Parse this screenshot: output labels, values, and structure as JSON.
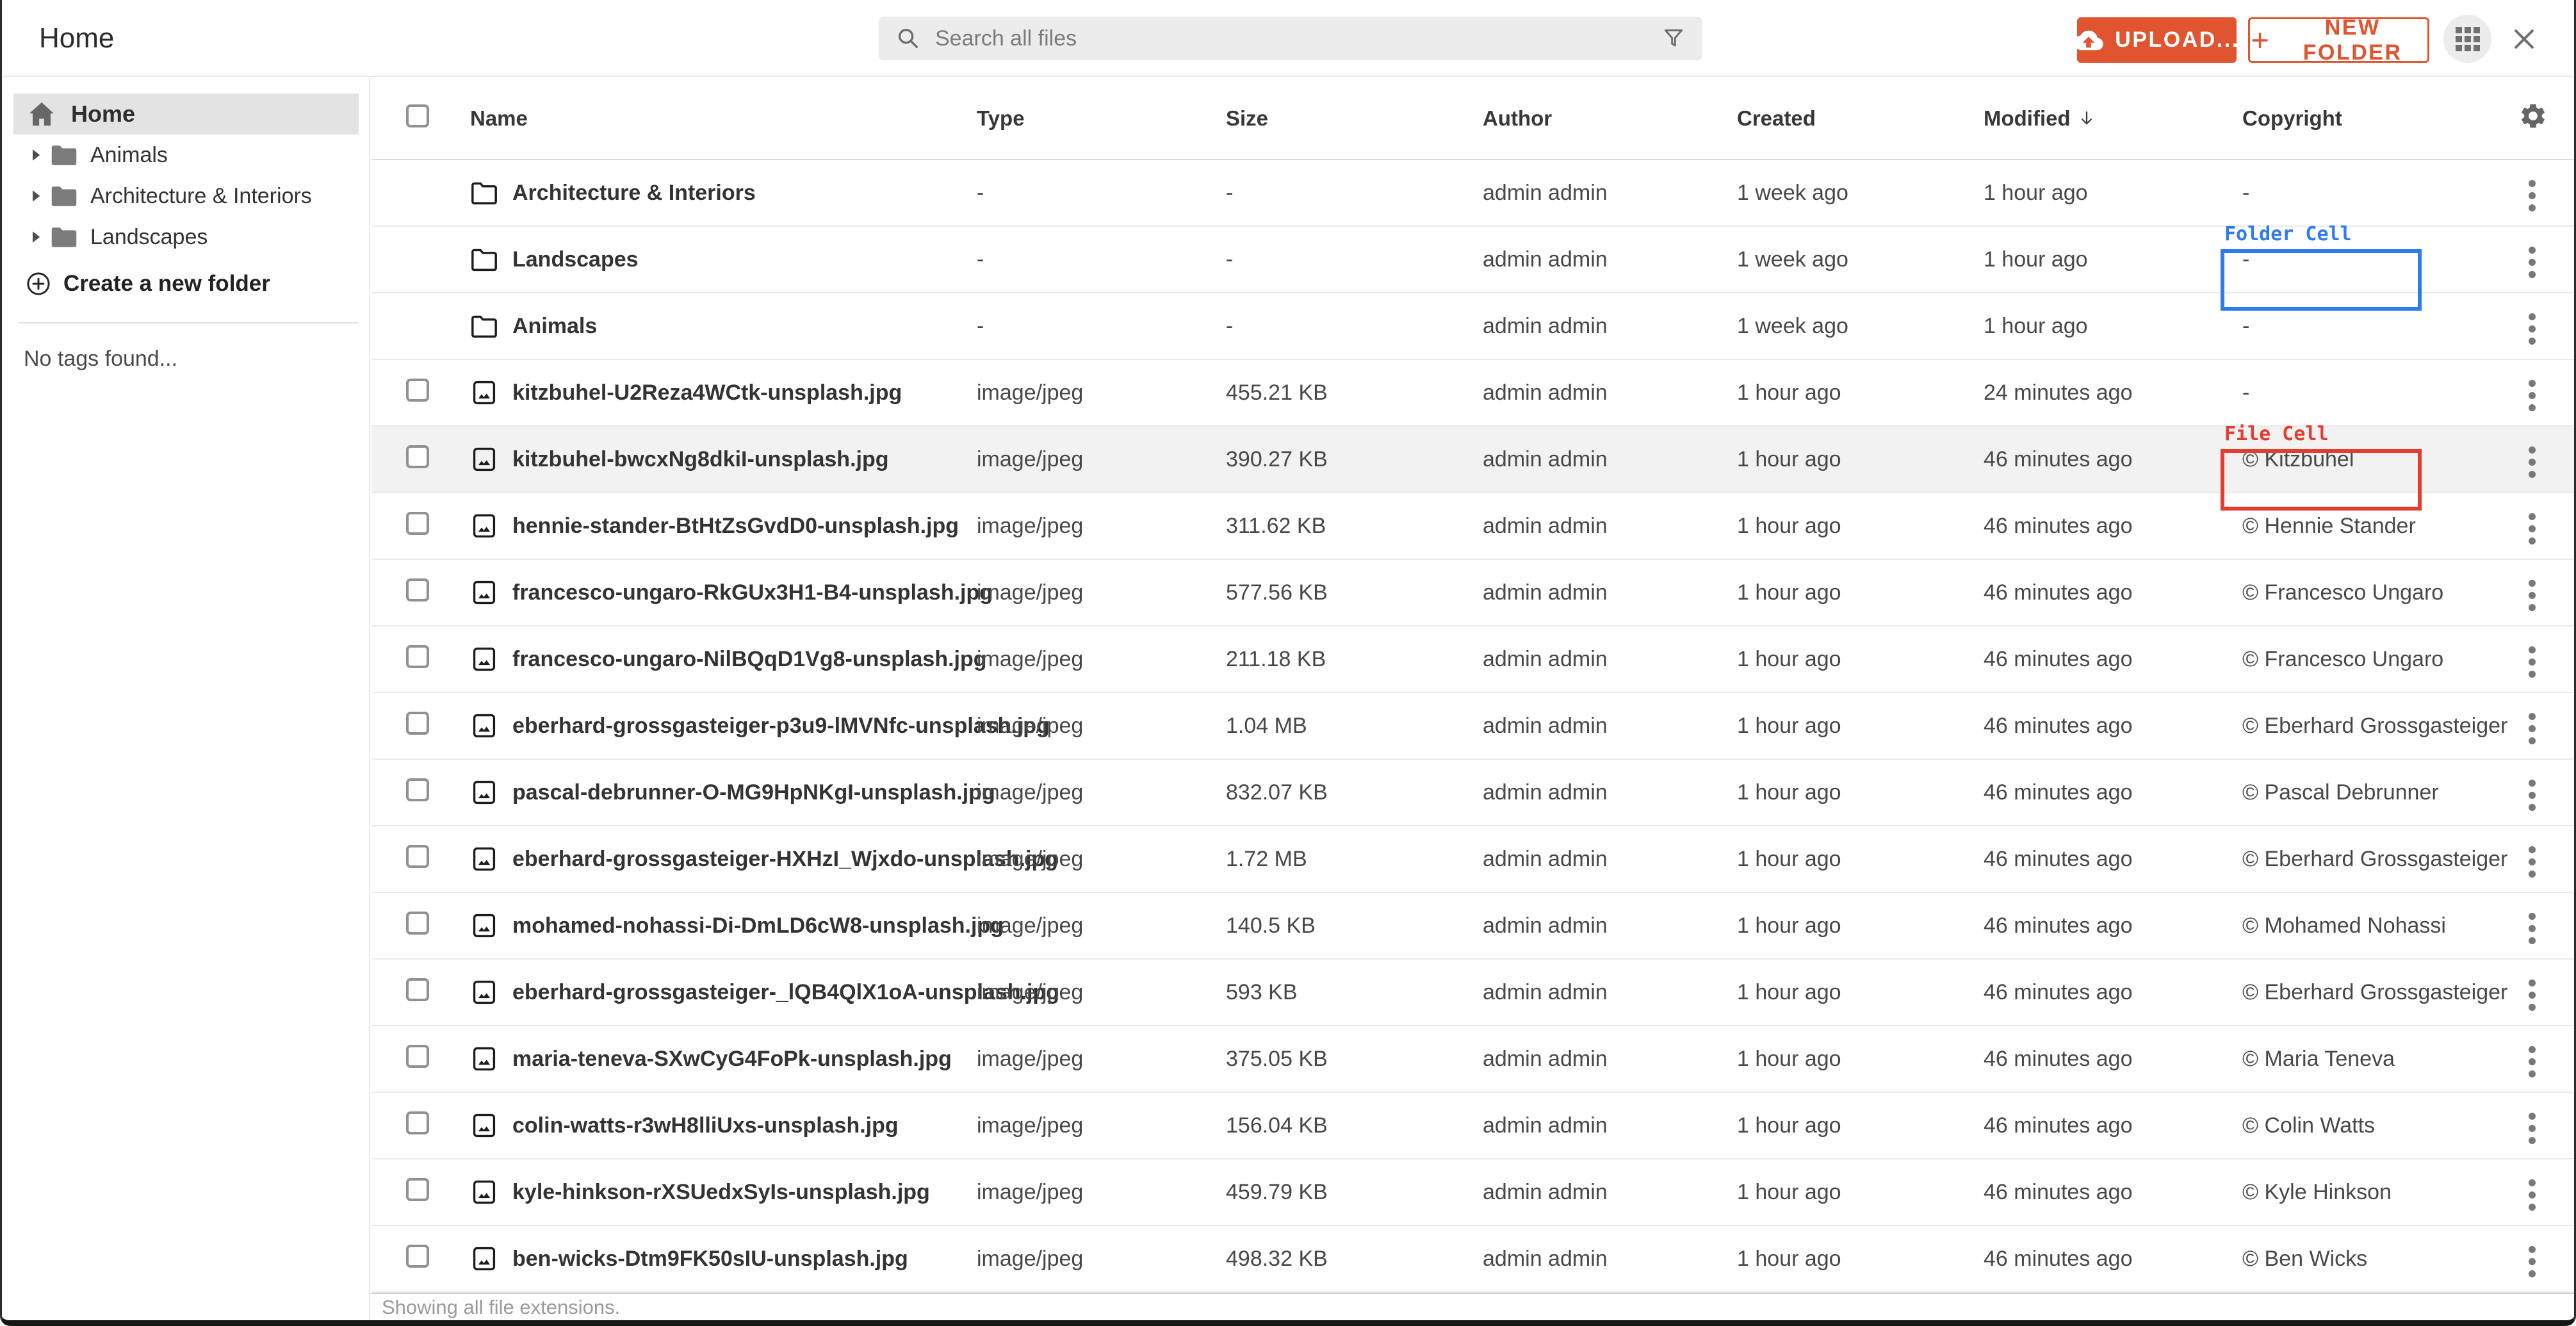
{
  "header": {
    "title": "Home",
    "search_placeholder": "Search all files",
    "upload_label": "UPLOAD...",
    "new_folder_label": "NEW FOLDER"
  },
  "sidebar": {
    "home_label": "Home",
    "folders": [
      {
        "label": "Animals"
      },
      {
        "label": "Architecture & Interiors"
      },
      {
        "label": "Landscapes"
      }
    ],
    "create_folder_label": "Create a new folder",
    "no_tags_text": "No tags found..."
  },
  "table": {
    "columns": [
      "Name",
      "Type",
      "Size",
      "Author",
      "Created",
      "Modified",
      "Copyright"
    ],
    "sorted_column": "Modified",
    "sort_direction": "desc",
    "rows": [
      {
        "kind": "folder",
        "name": "Architecture & Interiors",
        "type": "-",
        "size": "-",
        "author": "admin admin",
        "created": "1 week ago",
        "modified": "1 hour ago",
        "copyright": "-",
        "highlighted": false,
        "annotation": null
      },
      {
        "kind": "folder",
        "name": "Landscapes",
        "type": "-",
        "size": "-",
        "author": "admin admin",
        "created": "1 week ago",
        "modified": "1 hour ago",
        "copyright": "-",
        "highlighted": false,
        "annotation": "folder_cell"
      },
      {
        "kind": "folder",
        "name": "Animals",
        "type": "-",
        "size": "-",
        "author": "admin admin",
        "created": "1 week ago",
        "modified": "1 hour ago",
        "copyright": "-",
        "highlighted": false,
        "annotation": null
      },
      {
        "kind": "file",
        "name": "kitzbuhel-U2Reza4WCtk-unsplash.jpg",
        "type": "image/jpeg",
        "size": "455.21 KB",
        "author": "admin admin",
        "created": "1 hour ago",
        "modified": "24 minutes ago",
        "copyright": "-",
        "highlighted": false,
        "annotation": null
      },
      {
        "kind": "file",
        "name": "kitzbuhel-bwcxNg8dkiI-unsplash.jpg",
        "type": "image/jpeg",
        "size": "390.27 KB",
        "author": "admin admin",
        "created": "1 hour ago",
        "modified": "46 minutes ago",
        "copyright": "© Kitzbuhel",
        "highlighted": true,
        "annotation": "file_cell"
      },
      {
        "kind": "file",
        "name": "hennie-stander-BtHtZsGvdD0-unsplash.jpg",
        "type": "image/jpeg",
        "size": "311.62 KB",
        "author": "admin admin",
        "created": "1 hour ago",
        "modified": "46 minutes ago",
        "copyright": "© Hennie Stander",
        "highlighted": false,
        "annotation": null
      },
      {
        "kind": "file",
        "name": "francesco-ungaro-RkGUx3H1-B4-unsplash.jpg",
        "type": "image/jpeg",
        "size": "577.56 KB",
        "author": "admin admin",
        "created": "1 hour ago",
        "modified": "46 minutes ago",
        "copyright": "© Francesco Ungaro",
        "highlighted": false,
        "annotation": null
      },
      {
        "kind": "file",
        "name": "francesco-ungaro-NilBQqD1Vg8-unsplash.jpg",
        "type": "image/jpeg",
        "size": "211.18 KB",
        "author": "admin admin",
        "created": "1 hour ago",
        "modified": "46 minutes ago",
        "copyright": "© Francesco Ungaro",
        "highlighted": false,
        "annotation": null
      },
      {
        "kind": "file",
        "name": "eberhard-grossgasteiger-p3u9-lMVNfc-unsplash.jpg",
        "type": "image/jpeg",
        "size": "1.04 MB",
        "author": "admin admin",
        "created": "1 hour ago",
        "modified": "46 minutes ago",
        "copyright": "© Eberhard Grossgasteiger",
        "highlighted": false,
        "annotation": null
      },
      {
        "kind": "file",
        "name": "pascal-debrunner-O-MG9HpNKgI-unsplash.jpg",
        "type": "image/jpeg",
        "size": "832.07 KB",
        "author": "admin admin",
        "created": "1 hour ago",
        "modified": "46 minutes ago",
        "copyright": "© Pascal Debrunner",
        "highlighted": false,
        "annotation": null
      },
      {
        "kind": "file",
        "name": "eberhard-grossgasteiger-HXHzI_Wjxdo-unsplash.jpg",
        "type": "image/jpeg",
        "size": "1.72 MB",
        "author": "admin admin",
        "created": "1 hour ago",
        "modified": "46 minutes ago",
        "copyright": "© Eberhard Grossgasteiger",
        "highlighted": false,
        "annotation": null
      },
      {
        "kind": "file",
        "name": "mohamed-nohassi-Di-DmLD6cW8-unsplash.jpg",
        "type": "image/jpeg",
        "size": "140.5 KB",
        "author": "admin admin",
        "created": "1 hour ago",
        "modified": "46 minutes ago",
        "copyright": "© Mohamed Nohassi",
        "highlighted": false,
        "annotation": null
      },
      {
        "kind": "file",
        "name": "eberhard-grossgasteiger-_lQB4QlX1oA-unsplash.jpg",
        "type": "image/jpeg",
        "size": "593 KB",
        "author": "admin admin",
        "created": "1 hour ago",
        "modified": "46 minutes ago",
        "copyright": "© Eberhard Grossgasteiger",
        "highlighted": false,
        "annotation": null
      },
      {
        "kind": "file",
        "name": "maria-teneva-SXwCyG4FoPk-unsplash.jpg",
        "type": "image/jpeg",
        "size": "375.05 KB",
        "author": "admin admin",
        "created": "1 hour ago",
        "modified": "46 minutes ago",
        "copyright": "© Maria Teneva",
        "highlighted": false,
        "annotation": null
      },
      {
        "kind": "file",
        "name": "colin-watts-r3wH8lliUxs-unsplash.jpg",
        "type": "image/jpeg",
        "size": "156.04 KB",
        "author": "admin admin",
        "created": "1 hour ago",
        "modified": "46 minutes ago",
        "copyright": "© Colin Watts",
        "highlighted": false,
        "annotation": null
      },
      {
        "kind": "file",
        "name": "kyle-hinkson-rXSUedxSyIs-unsplash.jpg",
        "type": "image/jpeg",
        "size": "459.79 KB",
        "author": "admin admin",
        "created": "1 hour ago",
        "modified": "46 minutes ago",
        "copyright": "© Kyle Hinkson",
        "highlighted": false,
        "annotation": null
      },
      {
        "kind": "file",
        "name": "ben-wicks-Dtm9FK50sIU-unsplash.jpg",
        "type": "image/jpeg",
        "size": "498.32 KB",
        "author": "admin admin",
        "created": "1 hour ago",
        "modified": "46 minutes ago",
        "copyright": "© Ben Wicks",
        "highlighted": false,
        "annotation": null
      }
    ]
  },
  "annotations": {
    "folder_cell": {
      "label": "Folder Cell",
      "color": "#2e7bf0"
    },
    "file_cell": {
      "label": "File Cell",
      "color": "#e63c30"
    }
  },
  "footer": {
    "status": "Showing all file extensions."
  },
  "colors": {
    "accent": "#e0542f",
    "row_highlight": "#f2f2f2",
    "sidebar_selected": "#e3e3e3"
  }
}
